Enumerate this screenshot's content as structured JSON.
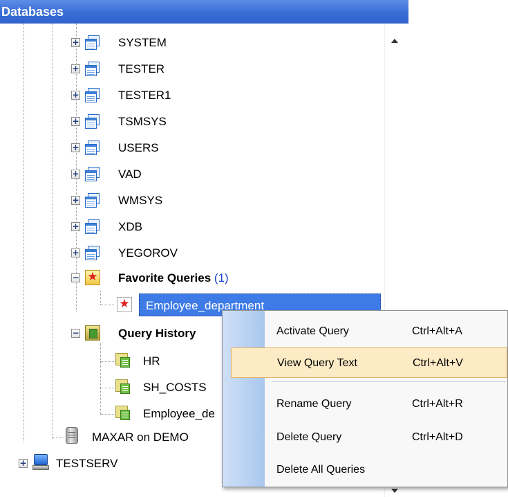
{
  "panel": {
    "title": "Databases"
  },
  "tree": {
    "schemas": [
      {
        "label": "SYSTEM"
      },
      {
        "label": "TESTER"
      },
      {
        "label": "TESTER1"
      },
      {
        "label": "TSMSYS"
      },
      {
        "label": "USERS"
      },
      {
        "label": "VAD"
      },
      {
        "label": "WMSYS"
      },
      {
        "label": "XDB"
      },
      {
        "label": "YEGOROV"
      }
    ],
    "favorites": {
      "label": "Favorite Queries",
      "count": "(1)",
      "items": [
        {
          "label": "Employee_department",
          "selected": true
        }
      ]
    },
    "history": {
      "label": "Query History",
      "items": [
        {
          "label": "HR"
        },
        {
          "label": "SH_COSTS"
        },
        {
          "label": "Employee_de"
        }
      ]
    },
    "connection": {
      "label": "MAXAR on DEMO"
    },
    "server": {
      "label": "TESTSERV"
    }
  },
  "context_menu": {
    "items": [
      {
        "label": "Activate Query",
        "shortcut": "Ctrl+Alt+A"
      },
      {
        "label": "View Query Text",
        "shortcut": "Ctrl+Alt+V",
        "highlighted": true
      },
      {
        "label": "Rename Query",
        "shortcut": "Ctrl+Alt+R"
      },
      {
        "label": "Delete Query",
        "shortcut": "Ctrl+Alt+D"
      },
      {
        "label": "Delete All Queries",
        "shortcut": ""
      }
    ]
  },
  "icons": {
    "schema": "database-schema-icon",
    "favorites": "star-folder-icon",
    "favorite_item": "star-icon",
    "history": "query-history-icon",
    "query": "query-icon",
    "connection": "database-cylinder-icon",
    "server": "server-computer-icon"
  },
  "colors": {
    "title_bar": "#3a6fd8",
    "selection": "#3e7be6",
    "menu_highlight": "#fdebc6",
    "count": "#1a3fcf"
  }
}
